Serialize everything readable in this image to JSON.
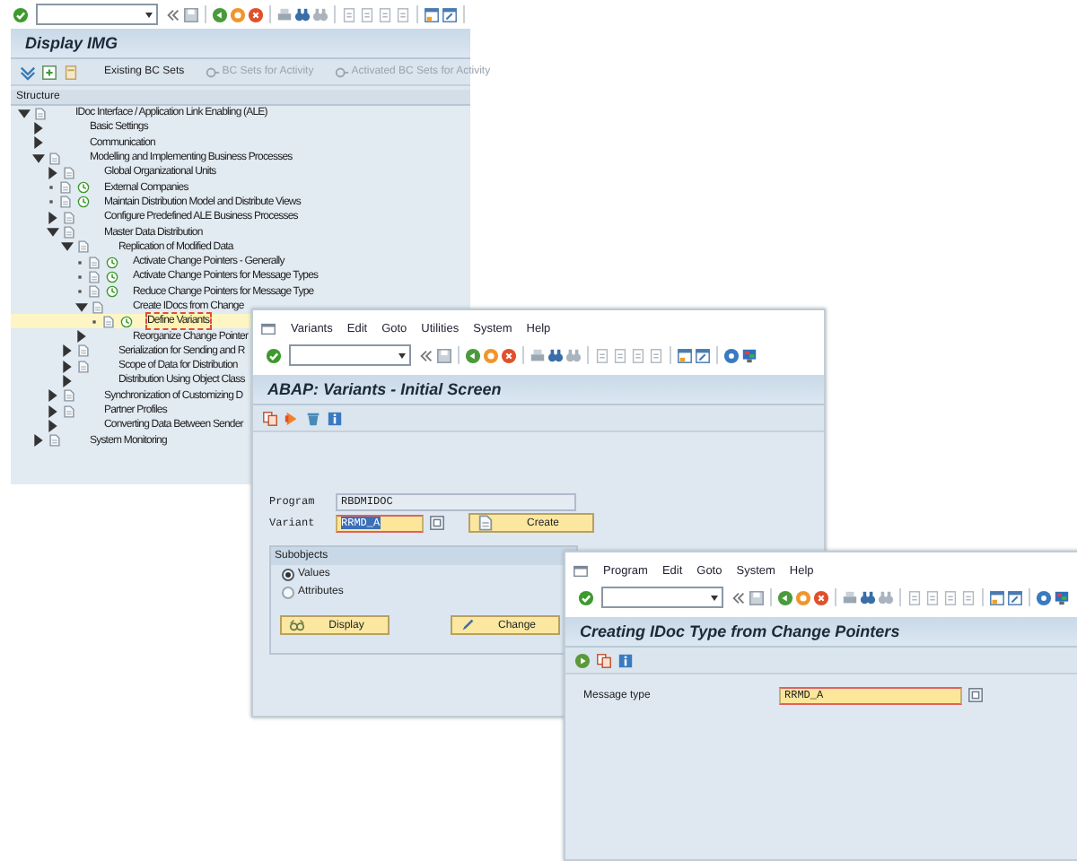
{
  "img_window": {
    "title": "Display IMG",
    "toolbar": [
      {
        "label": "Existing BC Sets",
        "disabled": false
      },
      {
        "label": "BC Sets for Activity",
        "disabled": true
      },
      {
        "label": "Activated BC Sets for Activity",
        "disabled": true
      }
    ],
    "structure": {
      "heading": "Structure",
      "items": [
        {
          "label": "IDoc Interface / Application Link Enabling (ALE)",
          "kind": "folder",
          "expanded": true,
          "doc": true,
          "activity": false,
          "selected": false,
          "children": [
            {
              "label": "Basic Settings",
              "kind": "folder",
              "expanded": false,
              "doc": false,
              "activity": false,
              "selected": false
            },
            {
              "label": "Communication",
              "kind": "folder",
              "expanded": false,
              "doc": false,
              "activity": false,
              "selected": false
            },
            {
              "label": "Modelling and Implementing Business Processes",
              "kind": "folder",
              "expanded": true,
              "doc": true,
              "activity": false,
              "selected": false,
              "children": [
                {
                  "label": "Global Organizational Units",
                  "kind": "folder",
                  "expanded": false,
                  "doc": true,
                  "activity": false,
                  "selected": false
                },
                {
                  "label": "External Companies",
                  "kind": "leaf",
                  "doc": true,
                  "activity": true,
                  "selected": false
                },
                {
                  "label": "Maintain Distribution Model and Distribute Views",
                  "kind": "leaf",
                  "doc": true,
                  "activity": true,
                  "selected": false
                },
                {
                  "label": "Configure Predefined ALE Business Processes",
                  "kind": "folder",
                  "expanded": false,
                  "doc": true,
                  "activity": false,
                  "selected": false
                },
                {
                  "label": "Master Data Distribution",
                  "kind": "folder",
                  "expanded": true,
                  "doc": true,
                  "activity": false,
                  "selected": false,
                  "children": [
                    {
                      "label": "Replication of Modified Data",
                      "kind": "folder",
                      "expanded": true,
                      "doc": true,
                      "activity": false,
                      "selected": false,
                      "children": [
                        {
                          "label": "Activate Change Pointers - Generally",
                          "kind": "leaf",
                          "doc": true,
                          "activity": true,
                          "selected": false
                        },
                        {
                          "label": "Activate Change Pointers for Message Types",
                          "kind": "leaf",
                          "doc": true,
                          "activity": true,
                          "selected": false
                        },
                        {
                          "label": "Reduce Change Pointers for Message Type",
                          "kind": "leaf",
                          "doc": true,
                          "activity": true,
                          "selected": false
                        },
                        {
                          "label": "Create IDocs from Change",
                          "kind": "folder",
                          "expanded": true,
                          "doc": true,
                          "activity": false,
                          "selected": false,
                          "children": [
                            {
                              "label": "Define Variants",
                              "kind": "leaf",
                              "doc": true,
                              "activity": true,
                              "selected": true
                            }
                          ]
                        },
                        {
                          "label": "Reorganize Change Pointer",
                          "kind": "folder",
                          "expanded": false,
                          "doc": false,
                          "activity": false,
                          "selected": false
                        }
                      ]
                    },
                    {
                      "label": "Serialization for Sending and R",
                      "kind": "folder",
                      "expanded": false,
                      "doc": true,
                      "activity": false,
                      "selected": false
                    },
                    {
                      "label": "Scope of Data for Distribution",
                      "kind": "folder",
                      "expanded": false,
                      "doc": true,
                      "activity": false,
                      "selected": false
                    },
                    {
                      "label": "Distribution Using Object Class",
                      "kind": "folder",
                      "expanded": false,
                      "doc": false,
                      "activity": false,
                      "selected": false
                    }
                  ]
                },
                {
                  "label": "Synchronization of Customizing D",
                  "kind": "folder",
                  "expanded": false,
                  "doc": true,
                  "activity": false,
                  "selected": false
                },
                {
                  "label": "Partner Profiles",
                  "kind": "folder",
                  "expanded": false,
                  "doc": true,
                  "activity": false,
                  "selected": false
                },
                {
                  "label": "Converting Data Between Sender",
                  "kind": "folder",
                  "expanded": false,
                  "doc": false,
                  "activity": false,
                  "selected": false
                }
              ]
            },
            {
              "label": "System Monitoring",
              "kind": "folder",
              "expanded": false,
              "doc": true,
              "activity": false,
              "selected": false
            }
          ]
        }
      ]
    }
  },
  "variants_window": {
    "menu": [
      "Variants",
      "Edit",
      "Goto",
      "Utilities",
      "System",
      "Help"
    ],
    "title": "ABAP: Variants - Initial Screen",
    "program": {
      "label": "Program",
      "value": "RBDMIDOC"
    },
    "variant": {
      "label": "Variant",
      "value": "RRMD_A"
    },
    "create_button": "Create",
    "subobjects": {
      "title": "Subobjects",
      "options": [
        {
          "label": "Values",
          "selected": true
        },
        {
          "label": "Attributes",
          "selected": false
        }
      ]
    },
    "buttons": [
      {
        "label": "Display",
        "kind": "display"
      },
      {
        "label": "Change",
        "kind": "change"
      }
    ]
  },
  "idoc_window": {
    "menu": [
      "Program",
      "Edit",
      "Goto",
      "System",
      "Help"
    ],
    "title": "Creating IDoc Type from Change Pointers",
    "message_type": {
      "label": "Message type",
      "value": "RRMD_A"
    }
  }
}
